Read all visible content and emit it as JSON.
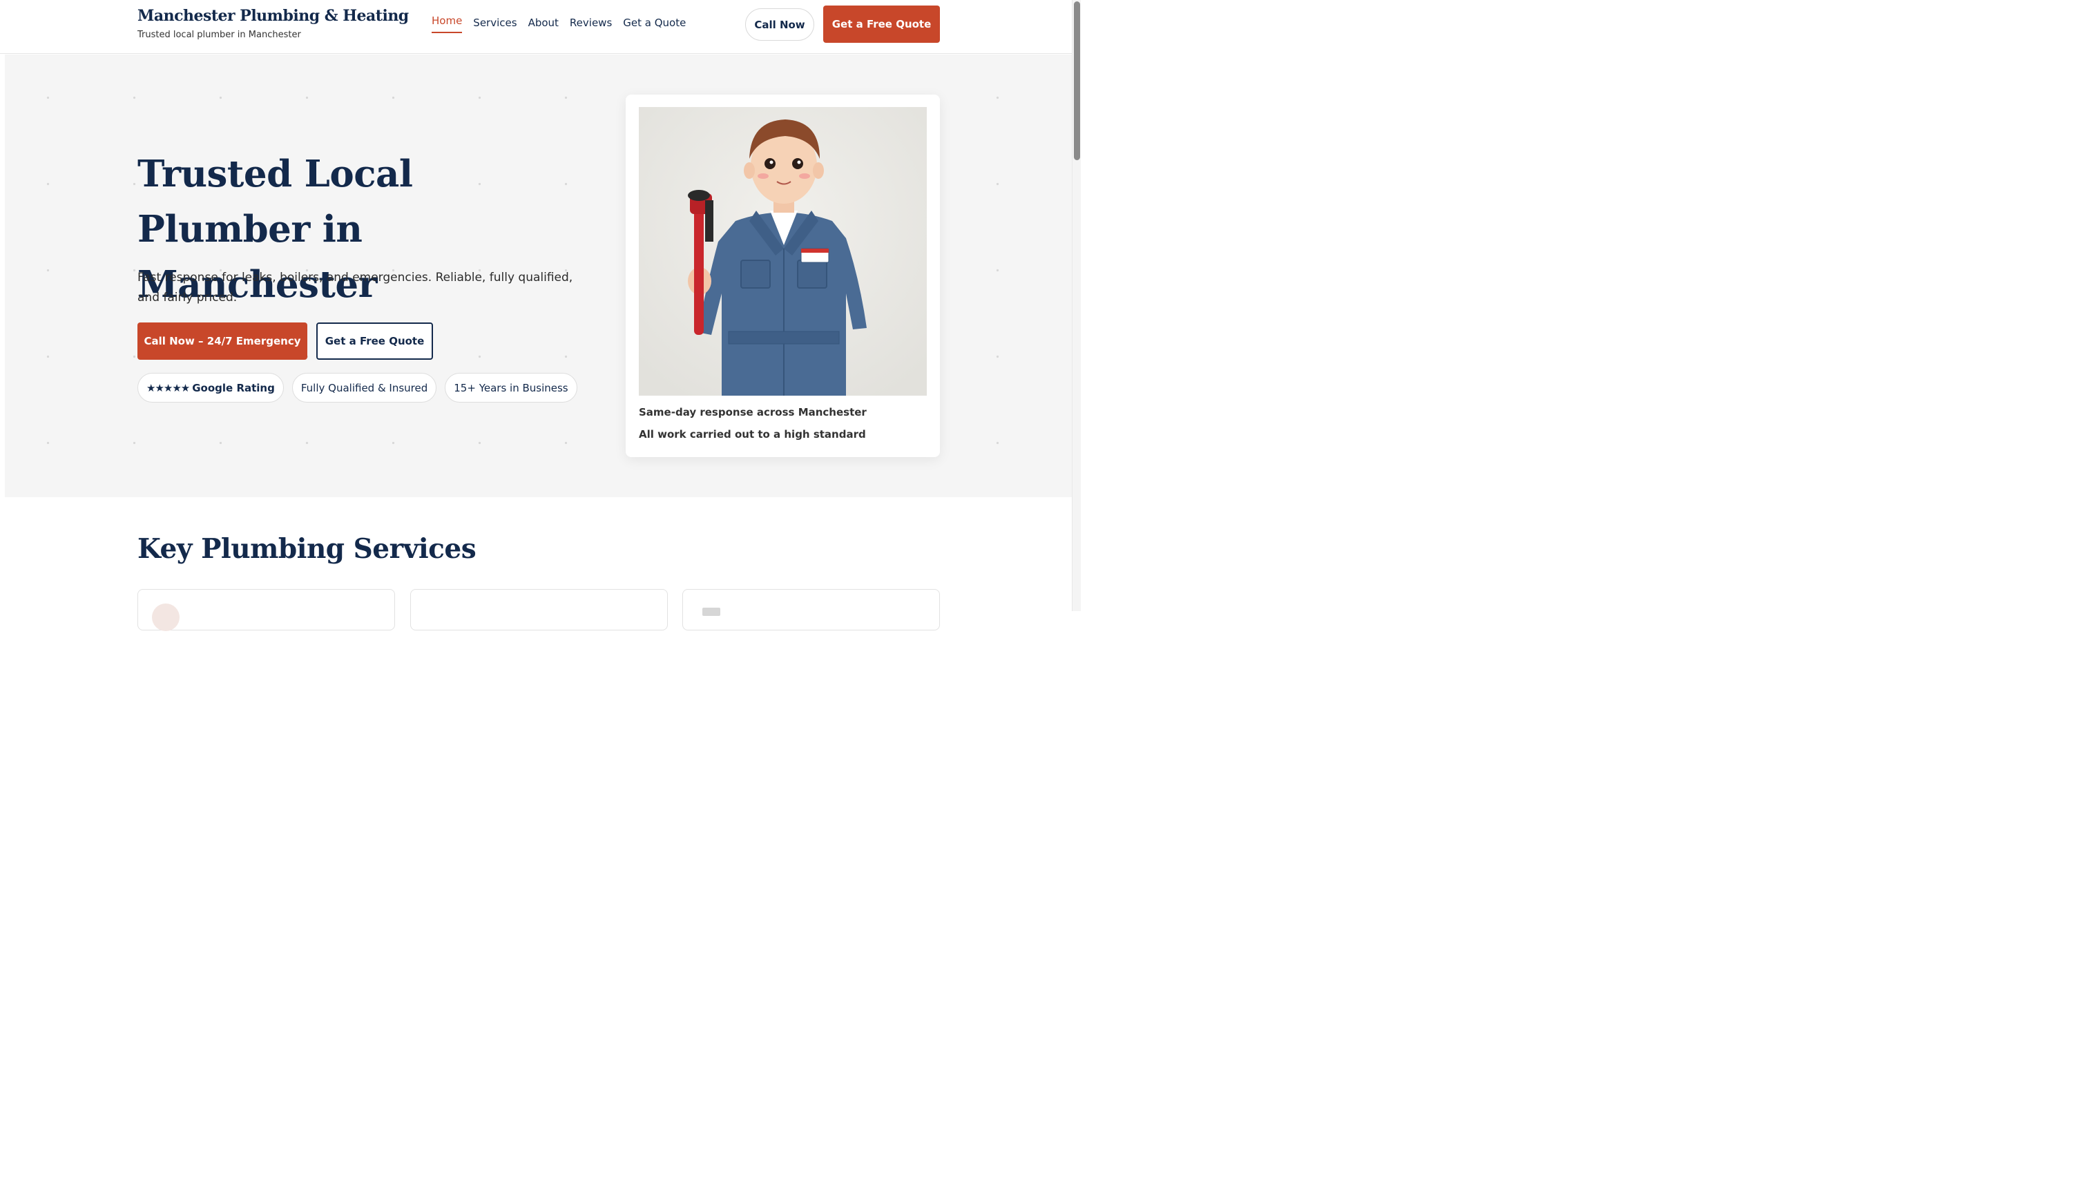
{
  "header": {
    "brand_name": "Manchester Plumbing & Heating",
    "tagline": "Trusted local plumber in Manchester",
    "nav": [
      "Home",
      "Services",
      "About",
      "Reviews",
      "Get a Quote"
    ],
    "active_nav": "Home",
    "call_button": "Call Now",
    "quote_button": "Get a Free Quote"
  },
  "hero": {
    "title": "Trusted Local Plumber in Manchester",
    "subtitle": "Fast response for leaks, boilers, and emergencies. Reliable, fully qualified, and fairly priced.",
    "call_button": "Call Now – 24/7 Emergency",
    "quote_button": "Get a Free Quote",
    "badges": {
      "rating_stars": "★★★★★",
      "rating_label": "Google Rating",
      "qualified": "Fully Qualified & Insured",
      "years": "15+ Years in Business"
    }
  },
  "card": {
    "image_icon": "plumber-with-wrench-illustration",
    "line1": "Same-day response across Manchester",
    "line2": "All work carried out to a high standard"
  },
  "services": {
    "title": "Key Plumbing Services"
  },
  "colors": {
    "brand_navy": "#13294b",
    "accent": "#c8472a",
    "hero_bg": "#f5f5f5"
  }
}
